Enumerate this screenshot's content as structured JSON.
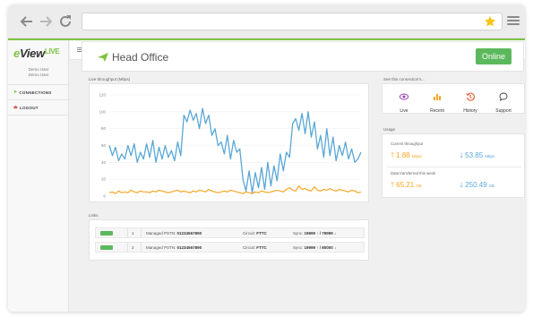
{
  "colors": {
    "accent": "#7dc242",
    "online": "#5cb85c",
    "orange": "#f5a623",
    "blue": "#5aa7d6"
  },
  "browser": {
    "back_icon": "arrow-left-icon",
    "forward_icon": "arrow-right-icon",
    "reload_icon": "reload-icon",
    "star_icon": "star-icon",
    "menu_icon": "hamburger-menu-icon"
  },
  "sidebar": {
    "logo_main": "View",
    "logo_e": "e",
    "logo_live": "LIVE",
    "user_line1": "Demo User",
    "user_line2": "Demo User",
    "items": [
      {
        "label": "CONNECTIONS",
        "icon": "plane-icon"
      },
      {
        "label": "LOGOUT",
        "icon": "logout-icon"
      }
    ]
  },
  "header": {
    "title": "Head Office",
    "status": "Online"
  },
  "chart_section": {
    "label": "Live throughput (Mbps)"
  },
  "chart_data": {
    "type": "line",
    "title": "Live throughput (Mbps)",
    "xlabel": "",
    "ylabel": "",
    "ylim": [
      0,
      120
    ],
    "yticks": [
      "0",
      "20",
      "40",
      "60",
      "80",
      "100",
      "120"
    ],
    "grid": true,
    "series": [
      {
        "color": "#5aa7d6",
        "values": [
          60,
          48,
          58,
          42,
          50,
          44,
          60,
          48,
          62,
          40,
          52,
          44,
          62,
          46,
          66,
          40,
          58,
          44,
          60,
          46,
          54,
          42,
          64,
          48,
          96,
          88,
          102,
          90,
          98,
          80,
          104,
          86,
          96,
          72,
          80,
          60,
          64,
          50,
          72,
          44,
          66,
          52,
          56,
          20,
          6,
          30,
          4,
          28,
          10,
          34,
          8,
          40,
          12,
          36,
          18,
          50,
          30,
          52,
          46,
          86,
          92,
          78,
          98,
          74,
          100,
          70,
          88,
          56,
          72,
          46,
          80,
          48,
          70,
          42,
          60,
          48,
          64,
          44,
          56,
          40,
          44,
          52
        ]
      },
      {
        "color": "#f5a623",
        "values": [
          4,
          5,
          3,
          6,
          4,
          5,
          4,
          7,
          5,
          4,
          6,
          5,
          5,
          4,
          6,
          5,
          7,
          6,
          5,
          4,
          5,
          6,
          7,
          5,
          6,
          5,
          4,
          6,
          5,
          7,
          6,
          5,
          8,
          6,
          5,
          4,
          5,
          6,
          5,
          7,
          6,
          5,
          4,
          3,
          5,
          4,
          3,
          5,
          4,
          6,
          5,
          4,
          5,
          6,
          7,
          6,
          5,
          8,
          10,
          7,
          6,
          12,
          8,
          9,
          7,
          6,
          11,
          7,
          6,
          8,
          7,
          9,
          7,
          6,
          8,
          7,
          6,
          5,
          7,
          6,
          4,
          5
        ]
      }
    ]
  },
  "links": {
    "label": "Links",
    "rows": [
      {
        "index": "1",
        "pstn_prefix": "Managed PSTN:",
        "pstn_number": "01234567890",
        "circuit_prefix": "Circuit:",
        "circuit": "FTTC",
        "sync_prefix": "Sync:",
        "sync": "19999 ↑ / 79999 ↓"
      },
      {
        "index": "2",
        "pstn_prefix": "Managed PSTN:",
        "pstn_number": "01234567890",
        "circuit_prefix": "Circuit:",
        "circuit": "FTTC",
        "sync_prefix": "Sync:",
        "sync": "19999 ↑ / 80000 ↓"
      }
    ]
  },
  "connection": {
    "label": "See this connection's...",
    "items": [
      {
        "label": "Live",
        "icon": "eye-icon"
      },
      {
        "label": "Recent",
        "icon": "bar-chart-icon"
      },
      {
        "label": "History",
        "icon": "history-icon"
      },
      {
        "label": "Support",
        "icon": "chat-icon"
      }
    ]
  },
  "usage": {
    "label": "Usage",
    "current_label": "Current throughput",
    "current_up": "1.88",
    "current_up_unit": "Mbps",
    "current_down": "53.85",
    "current_down_unit": "Mbps",
    "week_label": "Data transferred this week",
    "week_up": "65.21",
    "week_up_unit": "GB",
    "week_down": "250.49",
    "week_down_unit": "GB"
  }
}
